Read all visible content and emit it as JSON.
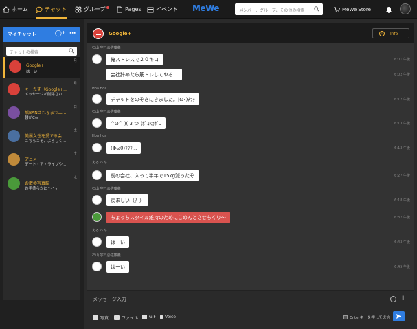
{
  "nav": {
    "home": "ホーム",
    "chat": "チャット",
    "group": "グループ",
    "pages": "Pages",
    "event": "イベント",
    "logo": "MeWe",
    "search_placeholder": "メンバー、グループ、その他の検索",
    "store": "MeWe Store"
  },
  "sidebar": {
    "title": "マイチャット",
    "search_placeholder": "チャットの検索",
    "items": [
      {
        "name": "Google+",
        "preview": "はーい",
        "day": "月",
        "color": "#d9413a"
      },
      {
        "name": "ぐーたす（Google+...",
        "preview": "メッセージが削除され...",
        "day": "月",
        "color": "#d9413a"
      },
      {
        "name": "垢BANされるまで工...",
        "preview": "麟がCw",
        "day": "日",
        "color": "#7a4fa0"
      },
      {
        "name": "美麗女性を愛でる会",
        "preview": "こちらこそ、よろしく...",
        "day": "土",
        "color": "#4a6fa0"
      },
      {
        "name": "アニメ",
        "preview": "デート・ア・ライブや...",
        "day": "土",
        "color": "#c08a3a"
      },
      {
        "name": "お散歩写真館",
        "preview": "お手柔らかに^-^v",
        "day": "木",
        "color": "#4a9a3a"
      }
    ]
  },
  "chat": {
    "title": "Google+",
    "info_label": "Info",
    "messages": [
      {
        "sender": "石山 宇八@佐藤義",
        "text": "俺ストレスで２０キロ",
        "time": "6:01 午後"
      },
      {
        "sender": "",
        "text": "会社辞めたら筋トレしてやる！",
        "time": "6:02 午後"
      },
      {
        "sender": "Hoa Hoa",
        "text": "チャットをのぞきにきました。|ω･)ﾁﾗｯ",
        "time": "6:12 午後"
      },
      {
        "sender": "石山 宇八@佐藤義",
        "text": "^ω^ )( 3 つ )ﾎﾞｺｽｶﾎﾞｺ",
        "time": "6:13 午後"
      },
      {
        "sender": "Hoa Hoa",
        "text": "(Φωθ)ﾌﾌﾌ...",
        "time": "6:13 午後"
      },
      {
        "sender": "えろ べん",
        "text": "前の会社、入って半年で15kg減ったぞ",
        "time": "6:27 午後"
      },
      {
        "sender": "石山 宇八@佐藤義",
        "text": "羨ましい（？）",
        "time": "6:18 午後"
      },
      {
        "sender": "",
        "text": "ちょっちスタイル維持のためにこめんとさせちくり～",
        "time": "6:37 午後"
      },
      {
        "sender": "えろ べん",
        "text": "はーい",
        "time": "6:43 午後"
      },
      {
        "sender": "石山 宇八@佐藤義",
        "text": "はーい",
        "time": "6:45 午後"
      }
    ]
  },
  "composer": {
    "placeholder": "メッセージ入力",
    "photo": "写真",
    "file": "ファイル",
    "gif": "GIF",
    "voice": "Voice",
    "enter_send": "Enterキーを押して送信"
  }
}
